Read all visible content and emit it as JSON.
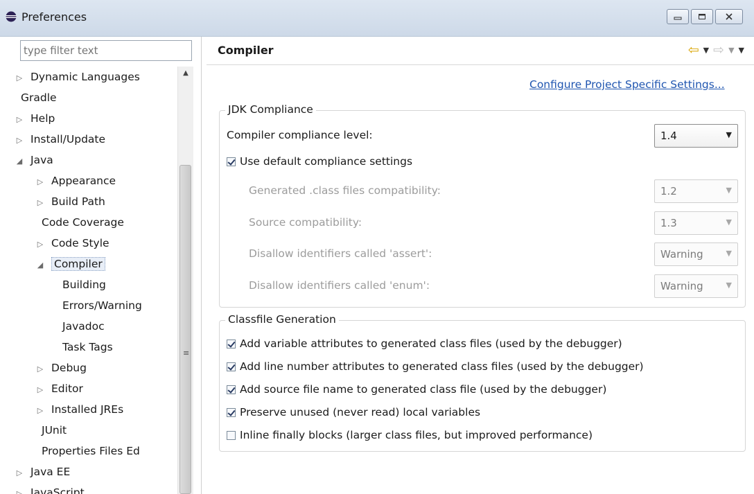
{
  "window": {
    "title": "Preferences"
  },
  "filter": {
    "placeholder": "type filter text"
  },
  "tree": [
    {
      "label": "Dynamic Languages",
      "indent": 0,
      "twisty": "collapsed"
    },
    {
      "label": "Gradle",
      "indent": 0,
      "twisty": "none"
    },
    {
      "label": "Help",
      "indent": 0,
      "twisty": "collapsed"
    },
    {
      "label": "Install/Update",
      "indent": 0,
      "twisty": "collapsed"
    },
    {
      "label": "Java",
      "indent": 0,
      "twisty": "expanded"
    },
    {
      "label": "Appearance",
      "indent": 1,
      "twisty": "collapsed"
    },
    {
      "label": "Build Path",
      "indent": 1,
      "twisty": "collapsed"
    },
    {
      "label": "Code Coverage",
      "indent": 1,
      "twisty": "none"
    },
    {
      "label": "Code Style",
      "indent": 1,
      "twisty": "collapsed"
    },
    {
      "label": "Compiler",
      "indent": 1,
      "twisty": "expanded",
      "selected": true
    },
    {
      "label": "Building",
      "indent": 2,
      "twisty": "none"
    },
    {
      "label": "Errors/Warning",
      "indent": 2,
      "twisty": "none"
    },
    {
      "label": "Javadoc",
      "indent": 2,
      "twisty": "none"
    },
    {
      "label": "Task Tags",
      "indent": 2,
      "twisty": "none"
    },
    {
      "label": "Debug",
      "indent": 1,
      "twisty": "collapsed"
    },
    {
      "label": "Editor",
      "indent": 1,
      "twisty": "collapsed"
    },
    {
      "label": "Installed JREs",
      "indent": 1,
      "twisty": "collapsed"
    },
    {
      "label": "JUnit",
      "indent": 1,
      "twisty": "none"
    },
    {
      "label": "Properties Files Ed",
      "indent": 1,
      "twisty": "none"
    },
    {
      "label": "Java EE",
      "indent": 0,
      "twisty": "collapsed"
    },
    {
      "label": "JavaScript",
      "indent": 0,
      "twisty": "collapsed"
    }
  ],
  "page": {
    "title": "Compiler",
    "configure_link": "Configure Project Specific Settings...",
    "jdk_group": {
      "legend": "JDK Compliance",
      "compliance_label": "Compiler compliance level:",
      "compliance_value": "1.4",
      "use_default_label": "Use default compliance settings",
      "use_default_checked": true,
      "generated_label": "Generated .class files compatibility:",
      "generated_value": "1.2",
      "source_label": "Source compatibility:",
      "source_value": "1.3",
      "assert_label": "Disallow identifiers called 'assert':",
      "assert_value": "Warning",
      "enum_label": "Disallow identifiers called 'enum':",
      "enum_value": "Warning"
    },
    "classfile_group": {
      "legend": "Classfile Generation",
      "options": [
        {
          "label": "Add variable attributes to generated class files (used by the debugger)",
          "checked": true
        },
        {
          "label": "Add line number attributes to generated class files (used by the debugger)",
          "checked": true
        },
        {
          "label": "Add source file name to generated class file (used by the debugger)",
          "checked": true
        },
        {
          "label": "Preserve unused (never read) local variables",
          "checked": true
        },
        {
          "label": "Inline finally blocks (larger class files, but improved performance)",
          "checked": false
        }
      ]
    }
  }
}
